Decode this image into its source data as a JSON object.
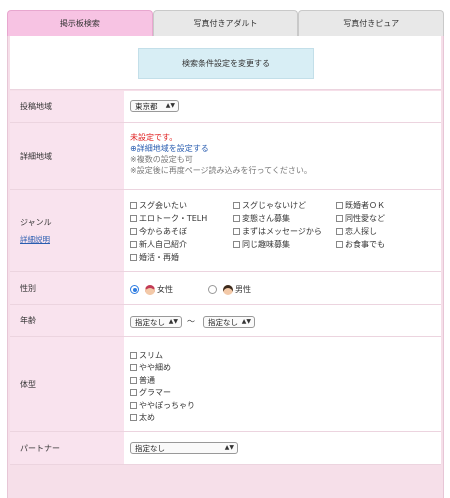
{
  "tabs": [
    {
      "label": "掲示板検索",
      "active": true
    },
    {
      "label": "写真付きアダルト",
      "active": false
    },
    {
      "label": "写真付きピュア",
      "active": false
    }
  ],
  "change_button": "検索条件設定を変更する",
  "post_area": {
    "label": "投稿地域",
    "value": "東京都"
  },
  "detail_area": {
    "label": "詳細地域",
    "unset": "未設定です。",
    "set_link": "詳細地域を設定する",
    "note1": "※複数の設定も可",
    "note2": "※設定後に再度ページ読み込みを行ってください。"
  },
  "genre": {
    "label": "ジャンル",
    "detail_link": "詳細説明",
    "items": [
      "スグ会いたい",
      "スグじゃないけど",
      "既婚者ＯＫ",
      "エロトーク・TELH",
      "変態さん募集",
      "同性愛など",
      "今からあそぼ",
      "まずはメッセージから",
      "恋人探し",
      "新人自己紹介",
      "同じ趣味募集",
      "お食事でも",
      "婚活・再婚"
    ]
  },
  "gender": {
    "label": "性別",
    "female": "女性",
    "male": "男性",
    "selected": "female"
  },
  "age": {
    "label": "年齢",
    "from": "指定なし",
    "separator": "〜",
    "to": "指定なし"
  },
  "body_type": {
    "label": "体型",
    "items": [
      "スリム",
      "やや細め",
      "普通",
      "グラマー",
      "ややぽっちゃり",
      "太め"
    ]
  },
  "partner": {
    "label": "パートナー",
    "value": "指定なし"
  }
}
